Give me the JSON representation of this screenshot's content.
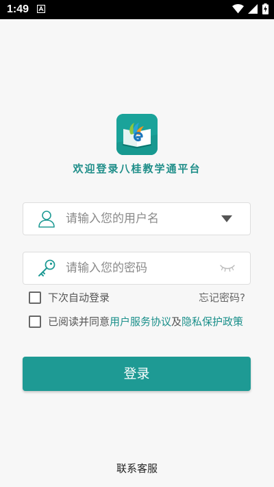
{
  "status_bar": {
    "time": "1:49",
    "notification_icon": "a-notification-icon",
    "wifi_icon": "wifi-icon",
    "signal_icon": "cell-signal-icon",
    "battery_icon": "battery-charging-icon"
  },
  "app": {
    "logo_icon": "book-logo-icon",
    "welcome_title": "欢迎登录八桂教学通平台"
  },
  "login_form": {
    "username": {
      "placeholder": "请输入您的用户名",
      "value": "",
      "icon": "user-icon",
      "dropdown_icon": "dropdown-triangle-icon"
    },
    "password": {
      "placeholder": "请输入您的密码",
      "value": "",
      "icon": "key-icon",
      "toggle_icon": "eye-closed-icon"
    },
    "remember_me": {
      "label": "下次自动登录",
      "checked": false
    },
    "forgot_password": "忘记密码?",
    "agreement": {
      "checked": false,
      "prefix": "已阅读并同意",
      "service_agreement": "用户服务协议",
      "conjunction": "及",
      "privacy_policy": "隐私保护政策"
    },
    "submit_label": "登录"
  },
  "footer": {
    "contact_service": "联系客服"
  },
  "colors": {
    "accent": "#1e9a94",
    "link": "#1a8f8a",
    "title": "#1f8e89",
    "background": "#f7f7f7"
  }
}
